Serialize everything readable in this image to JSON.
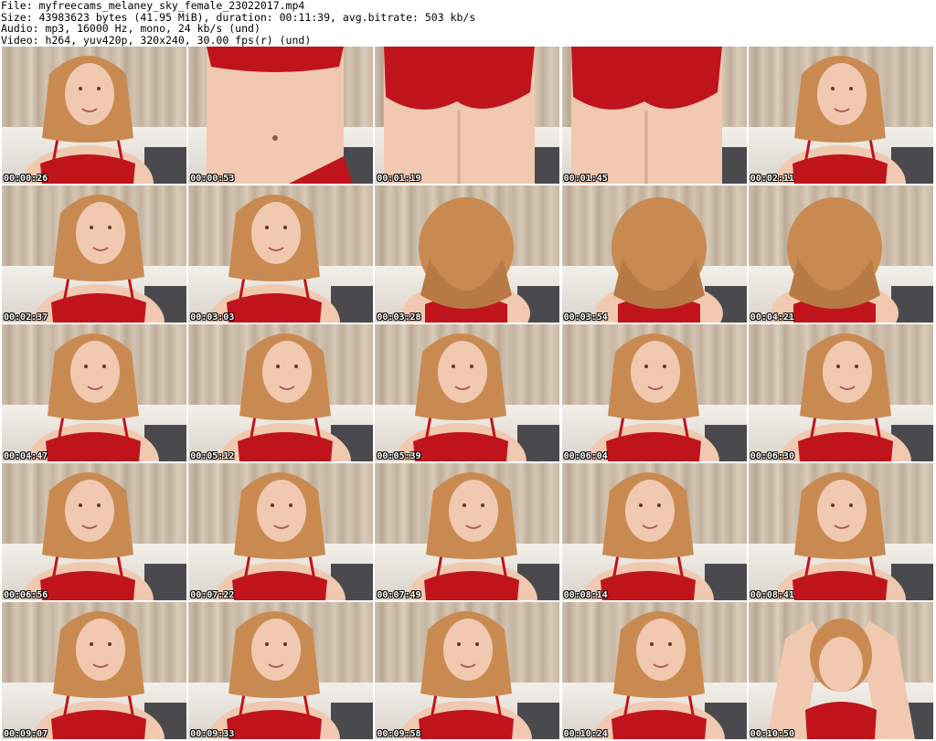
{
  "header": {
    "file": "File: myfreecams_melaney_sky_female_23022017.mp4",
    "size": "Size: 43983623 bytes (41.95 MiB), duration: 00:11:39, avg.bitrate: 503 kb/s",
    "audio": "Audio: mp3, 16000 Hz, mono, 24 kb/s (und)",
    "video": "Video: h264, yuv420p, 320x240, 30.00 fps(r) (und)"
  },
  "colors": {
    "background": "#ffffff",
    "timestamp": "#ffffff",
    "garment": "#c0141c",
    "hair": "#c98a52",
    "skin": "#f0c9b0"
  },
  "frames": [
    {
      "time": "00:00:26",
      "view": "portrait"
    },
    {
      "time": "00:00:53",
      "view": "torso"
    },
    {
      "time": "00:01:19",
      "view": "lower"
    },
    {
      "time": "00:01:45",
      "view": "lower"
    },
    {
      "time": "00:02:11",
      "view": "portrait"
    },
    {
      "time": "00:02:37",
      "view": "portrait"
    },
    {
      "time": "00:03:03",
      "view": "portrait"
    },
    {
      "time": "00:03:28",
      "view": "leaning"
    },
    {
      "time": "00:03:54",
      "view": "leaning"
    },
    {
      "time": "00:04:21",
      "view": "leaning"
    },
    {
      "time": "00:04:47",
      "view": "portrait"
    },
    {
      "time": "00:05:12",
      "view": "portrait"
    },
    {
      "time": "00:05:39",
      "view": "portrait"
    },
    {
      "time": "00:06:04",
      "view": "portrait"
    },
    {
      "time": "00:06:30",
      "view": "portrait"
    },
    {
      "time": "00:06:56",
      "view": "portrait"
    },
    {
      "time": "00:07:22",
      "view": "portrait"
    },
    {
      "time": "00:07:49",
      "view": "portrait"
    },
    {
      "time": "00:08:14",
      "view": "portrait"
    },
    {
      "time": "00:08:41",
      "view": "portrait"
    },
    {
      "time": "00:09:07",
      "view": "portrait"
    },
    {
      "time": "00:09:33",
      "view": "portrait"
    },
    {
      "time": "00:09:58",
      "view": "portrait"
    },
    {
      "time": "00:10:24",
      "view": "portrait"
    },
    {
      "time": "00:10:50",
      "view": "arms-up"
    }
  ]
}
